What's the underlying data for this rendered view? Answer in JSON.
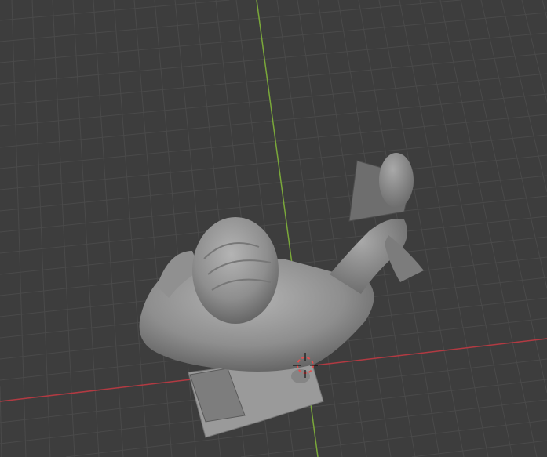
{
  "viewport": {
    "background": "#3d3d3d",
    "grid_color": "#4a4a4a",
    "x_axis_color": "#b23a42",
    "y_axis_color": "#7aa83a",
    "object_color": "#8f8f8f",
    "cursor_color": "#e05050"
  }
}
